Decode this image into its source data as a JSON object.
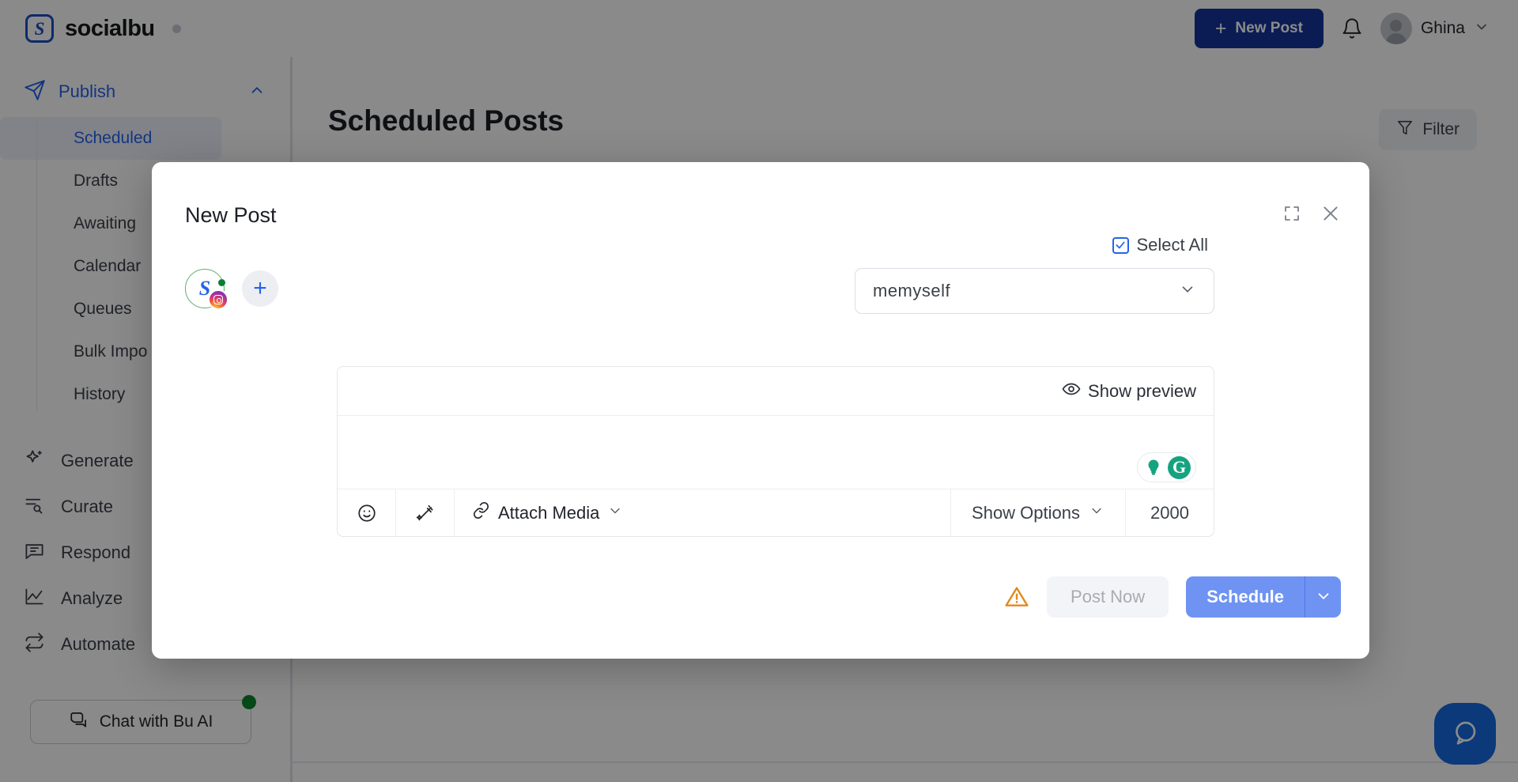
{
  "brand": {
    "name": "socialbu",
    "mark": "S",
    "accent": "#15349b"
  },
  "topbar": {
    "new_post_label": "New Post",
    "new_post_plus": "+",
    "user_name": "Ghina"
  },
  "sidebar": {
    "section": {
      "label": "Publish"
    },
    "sub_items": [
      {
        "label": "Scheduled",
        "active": true
      },
      {
        "label": "Drafts",
        "active": false
      },
      {
        "label": "Awaiting ",
        "active": false
      },
      {
        "label": "Calendar",
        "active": false
      },
      {
        "label": "Queues",
        "active": false
      },
      {
        "label": "Bulk Impo",
        "active": false
      },
      {
        "label": "History",
        "active": false
      }
    ],
    "main_items": [
      {
        "label": "Generate",
        "icon": "sparkle-icon"
      },
      {
        "label": "Curate",
        "icon": "curate-icon"
      },
      {
        "label": "Respond",
        "icon": "chat-box-icon"
      },
      {
        "label": "Analyze",
        "icon": "line-chart-icon"
      },
      {
        "label": "Automate",
        "icon": "loop-icon"
      }
    ],
    "chat_button": {
      "label": "Chat with Bu AI",
      "status_color": "#0b8a2e"
    }
  },
  "page": {
    "title": "Scheduled Posts",
    "filter_label": "Filter"
  },
  "modal": {
    "title": "New Post",
    "expand_icon": "expand-icon",
    "close_icon": "close-icon",
    "account": {
      "name_mark": "S",
      "platform": "instagram",
      "add_label": "+"
    },
    "select_all": {
      "label": "Select All",
      "checked": true
    },
    "account_select": {
      "value": "memyself"
    },
    "editor": {
      "show_preview_label": "Show preview",
      "text": "",
      "grammarly": {
        "letter": "G",
        "color": "#15a37f"
      }
    },
    "toolbar": {
      "emoji_icon": "emoji-icon",
      "ai_icon": "magic-wand-icon",
      "attach_label": "Attach Media",
      "options_label": "Show Options",
      "char_count": "2000"
    },
    "footer": {
      "warning_icon": "warning-triangle-icon",
      "post_now_label": "Post Now",
      "schedule_label": "Schedule",
      "schedule_color": "#6e93f2"
    }
  },
  "chat_widget": {
    "icon": "chat-bubble-icon",
    "color": "#1769e0"
  }
}
